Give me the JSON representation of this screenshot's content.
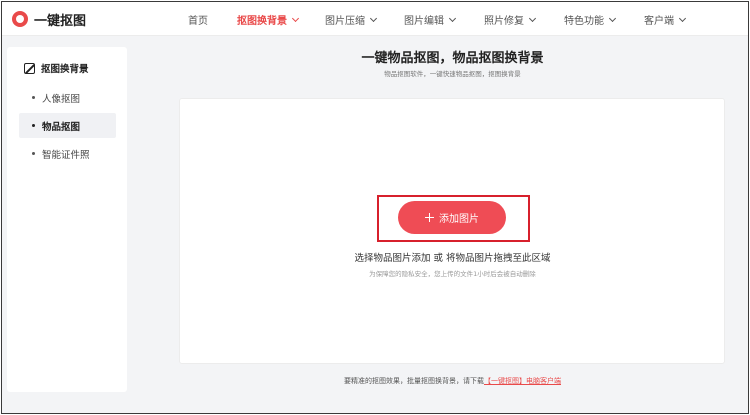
{
  "header": {
    "logo_text": "一键抠图",
    "nav": [
      {
        "label": "首页",
        "has_dropdown": false,
        "active": false
      },
      {
        "label": "抠图换背景",
        "has_dropdown": true,
        "active": true
      },
      {
        "label": "图片压缩",
        "has_dropdown": true,
        "active": false
      },
      {
        "label": "图片编辑",
        "has_dropdown": true,
        "active": false
      },
      {
        "label": "照片修复",
        "has_dropdown": true,
        "active": false
      },
      {
        "label": "特色功能",
        "has_dropdown": true,
        "active": false
      },
      {
        "label": "客户端",
        "has_dropdown": true,
        "active": false
      }
    ]
  },
  "sidebar": {
    "title": "抠图换背景",
    "items": [
      {
        "label": "人像抠图",
        "active": false
      },
      {
        "label": "物品抠图",
        "active": true
      },
      {
        "label": "智能证件照",
        "active": false
      }
    ]
  },
  "main": {
    "title": "一键物品抠图，物品抠图换背景",
    "subtitle": "物品抠图软件，一键快速物品抠图，抠图换背景",
    "add_button_label": "添加图片",
    "upload_hint": "选择物品图片添加 或 将物品图片拖拽至此区域",
    "privacy_note": "为保障您的隐私安全，您上传的文件1小时后会被自动删除",
    "footer_text": "要精准的抠图效果，批量抠图换背景，请下载",
    "footer_link": "【一键抠图】电脑客户端"
  },
  "colors": {
    "accent": "#e94a4a",
    "button": "#ef4c55",
    "highlight_border": "#d7202c"
  }
}
